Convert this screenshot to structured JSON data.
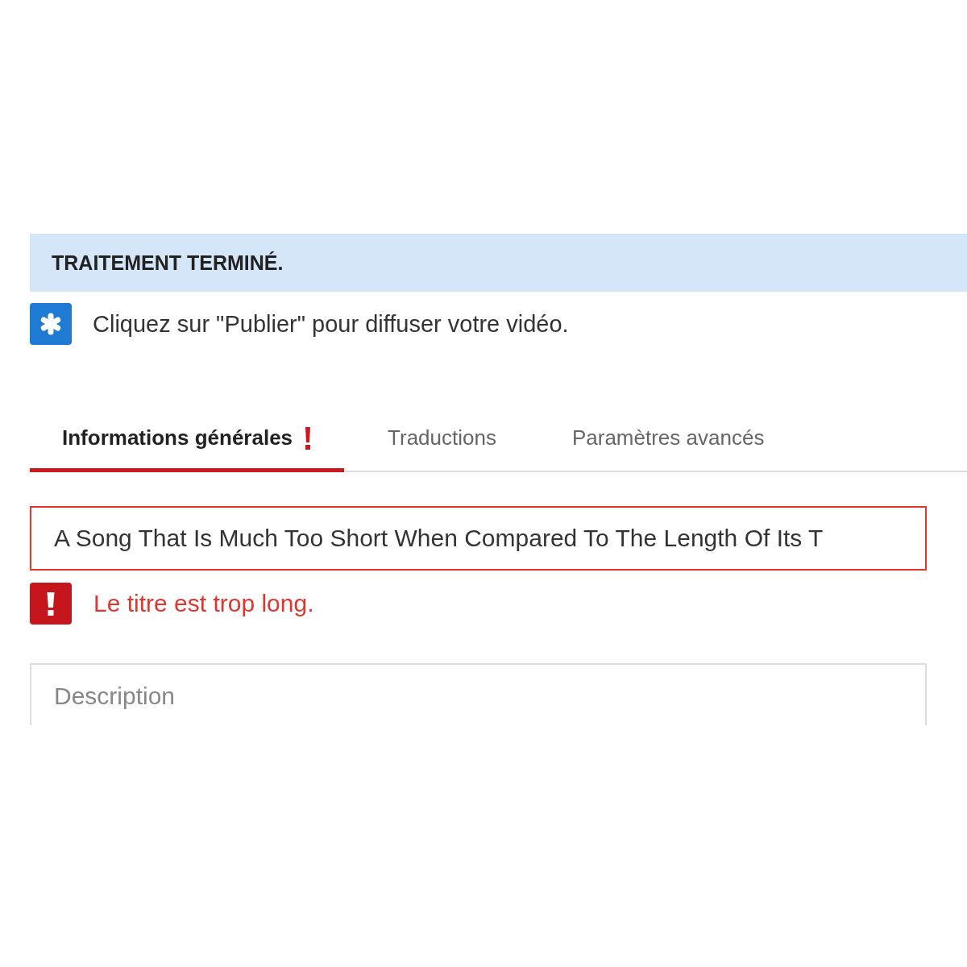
{
  "banner": {
    "text": "TRAITEMENT TERMINÉ."
  },
  "notice": {
    "text": "Cliquez sur \"Publier\" pour diffuser votre vidéo."
  },
  "tabs": [
    {
      "label": "Informations générales",
      "selected": true,
      "error": true
    },
    {
      "label": "Traductions",
      "selected": false,
      "error": false
    },
    {
      "label": "Paramètres avancés",
      "selected": false,
      "error": false
    }
  ],
  "title_field": {
    "value": "A Song That Is Much Too Short When Compared To The Length Of Its T",
    "error": true,
    "error_message": "Le titre est trop long."
  },
  "description_field": {
    "placeholder": "Description"
  }
}
